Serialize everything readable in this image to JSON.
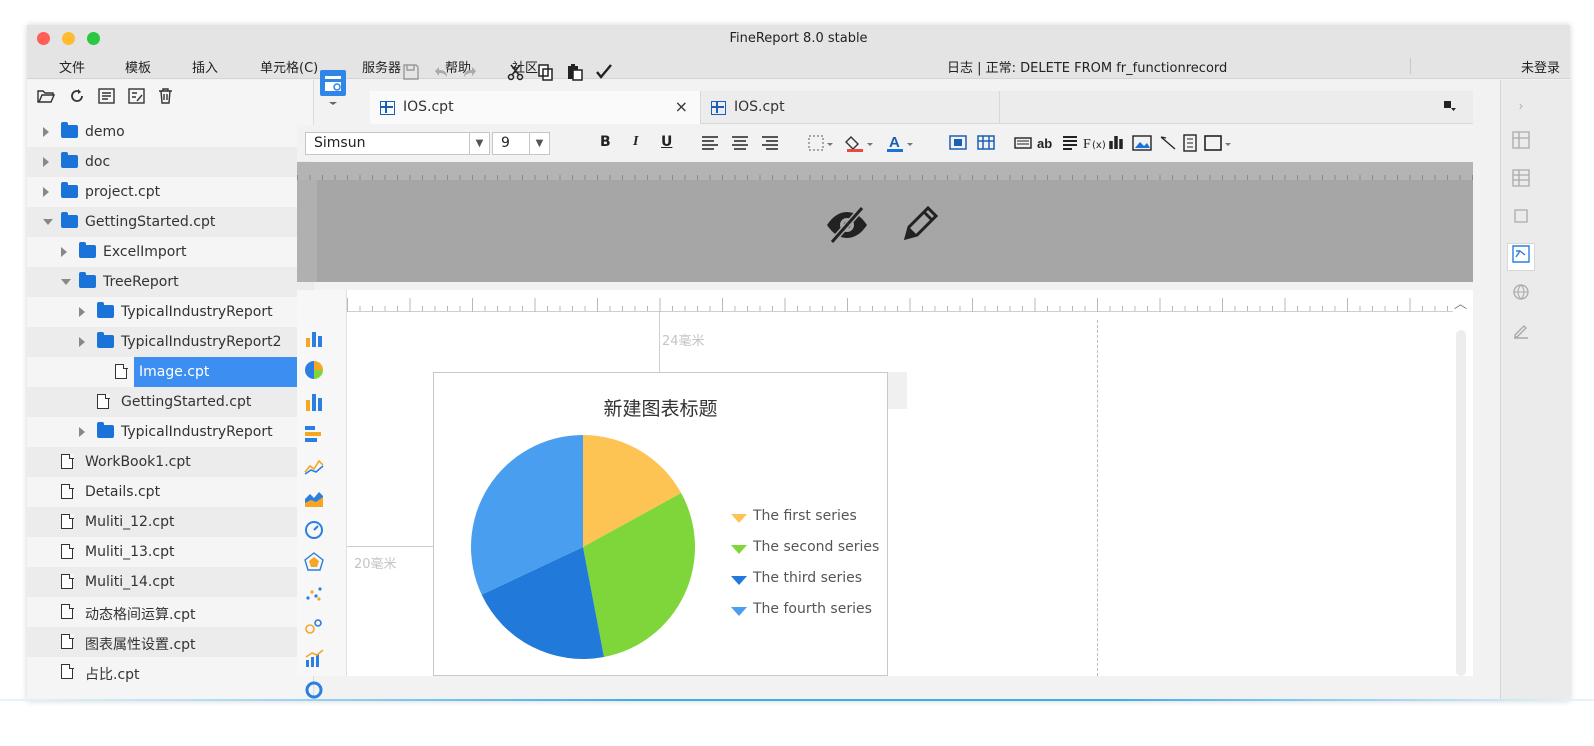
{
  "window": {
    "title": "FineReport 8.0 stable",
    "traffic_lights": {
      "close": "#ff5f57",
      "minimize": "#febc2e",
      "zoom": "#28c840"
    }
  },
  "menubar": {
    "items": [
      "文件",
      "模板",
      "插入",
      "单元格(C)",
      "服务器",
      "帮助",
      "社区"
    ],
    "log_text": "日志 | 正常: DELETE FROM fr_functionrecord",
    "login_label": "未登录"
  },
  "file_tree": {
    "toolbar_icons": [
      "open-folder-icon",
      "refresh-icon",
      "properties-icon",
      "edit-template-icon",
      "delete-icon"
    ],
    "items": [
      {
        "label": "demo",
        "type": "folder",
        "level": 0,
        "expanded": false
      },
      {
        "label": "doc",
        "type": "folder",
        "level": 0,
        "expanded": false
      },
      {
        "label": "project.cpt",
        "type": "folder",
        "level": 0,
        "expanded": false
      },
      {
        "label": "GettingStarted.cpt",
        "type": "folder",
        "level": 0,
        "expanded": true
      },
      {
        "label": "ExcelImport",
        "type": "folder",
        "level": 1,
        "expanded": false
      },
      {
        "label": "TreeReport",
        "type": "folder",
        "level": 1,
        "expanded": true
      },
      {
        "label": "TypicalIndustryReport",
        "type": "folder",
        "level": 2,
        "expanded": false
      },
      {
        "label": "TypicalIndustryReport2",
        "type": "folder",
        "level": 2,
        "expanded": false
      },
      {
        "label": "Image.cpt",
        "type": "file",
        "level": 3,
        "selected": true
      },
      {
        "label": "GettingStarted.cpt",
        "type": "file",
        "level": 2
      },
      {
        "label": "TypicalIndustryReport",
        "type": "folder",
        "level": 2,
        "expanded": false
      },
      {
        "label": "WorkBook1.cpt",
        "type": "file",
        "level": 0
      },
      {
        "label": "Details.cpt",
        "type": "file",
        "level": 0
      },
      {
        "label": "Muliti_12.cpt",
        "type": "file",
        "level": 0
      },
      {
        "label": "Muliti_13.cpt",
        "type": "file",
        "level": 0
      },
      {
        "label": "Muliti_14.cpt",
        "type": "file",
        "level": 0
      },
      {
        "label": "动态格间运算.cpt",
        "type": "file",
        "level": 0
      },
      {
        "label": "图表属性设置.cpt",
        "type": "file",
        "level": 0
      },
      {
        "label": "占比.cpt",
        "type": "file",
        "level": 0
      }
    ]
  },
  "tabs": [
    {
      "label": "IOS.cpt",
      "active": true,
      "close": "×"
    },
    {
      "label": "IOS.cpt",
      "active": false
    }
  ],
  "format_bar": {
    "font_family": "Simsun",
    "font_size": "9",
    "bold": "B",
    "italic": "I",
    "underline": "U"
  },
  "canvas": {
    "ruler_top_label": "24毫米",
    "ruler_left_label": "20毫米"
  },
  "chart_data": {
    "type": "pie",
    "title": "新建图表标题",
    "categories": [
      "The first series",
      "The second series",
      "The third series",
      "The fourth series"
    ],
    "values": [
      17,
      30,
      21,
      32
    ],
    "colors": [
      "#fdc453",
      "#7fd63a",
      "#2179d9",
      "#4a9ef0"
    ],
    "legend": "right"
  },
  "colors": {
    "accent": "#3c8ff0",
    "folder": "#1a73d9"
  }
}
